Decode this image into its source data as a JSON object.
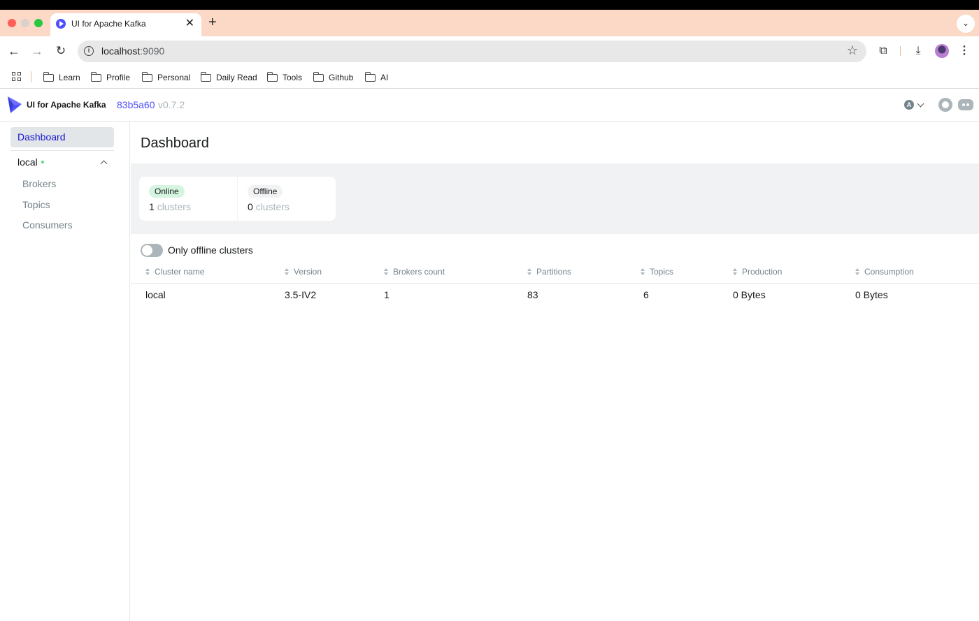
{
  "browser": {
    "tab_title": "UI for Apache Kafka",
    "url_host": "localhost",
    "url_port": ":9090",
    "bookmarks": [
      "Learn",
      "Profile",
      "Personal",
      "Daily Read",
      "Tools",
      "Github",
      "AI"
    ]
  },
  "header": {
    "app_name": "UI for Apache Kafka",
    "version_hash": "83b5a60",
    "version_number": "v0.7.2",
    "user_initial": "A"
  },
  "sidebar": {
    "dashboard_label": "Dashboard",
    "cluster_name": "local",
    "cluster_status_color": "#5cd685",
    "items": [
      "Brokers",
      "Topics",
      "Consumers"
    ]
  },
  "main": {
    "title": "Dashboard",
    "stats": [
      {
        "tag": "Online",
        "value": "1",
        "unit": "clusters"
      },
      {
        "tag": "Offline",
        "value": "0",
        "unit": "clusters"
      }
    ],
    "toggle_label": "Only offline clusters",
    "table": {
      "columns": [
        "Cluster name",
        "Version",
        "Brokers count",
        "Partitions",
        "Topics",
        "Production",
        "Consumption"
      ],
      "rows": [
        {
          "cluster_name": "local",
          "version": "3.5-IV2",
          "brokers": "1",
          "partitions": "83",
          "topics": "6",
          "production": "0 Bytes",
          "consumption": "0 Bytes"
        }
      ]
    }
  },
  "colors": {
    "accent": "#4f4fff",
    "online_tag": "#d6f5e0",
    "tab_strip": "#fcd9c7"
  }
}
